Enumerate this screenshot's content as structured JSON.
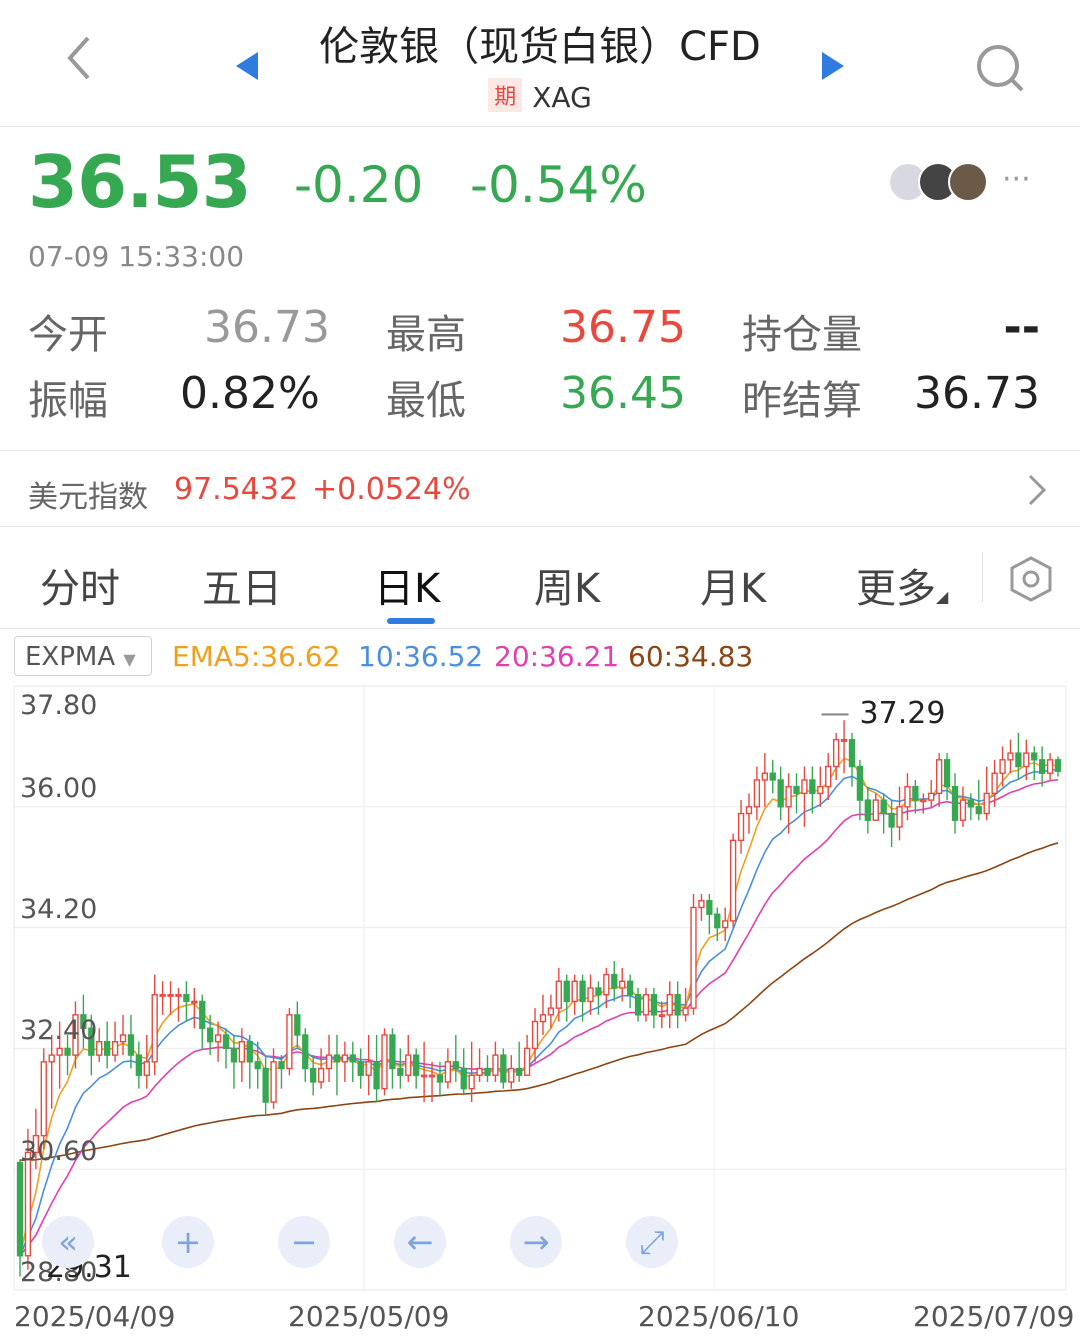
{
  "header": {
    "back_icon": "chevron-left-icon",
    "prev_icon": "triangle-left-icon",
    "next_icon": "triangle-right-icon",
    "search_icon": "search-icon",
    "title": "伦敦银（现货白银）CFD",
    "badge": "期",
    "symbol": "XAG"
  },
  "quote": {
    "price": "36.53",
    "change": "-0.20",
    "change_pct": "-0.54%",
    "timestamp": "07-09 15:33:00",
    "more_icon": "ellipsis-icon",
    "colors": {
      "down": "#36a852",
      "up": "#e8493f"
    }
  },
  "stats": [
    {
      "label": "今开",
      "value": "36.73",
      "color": "#999999"
    },
    {
      "label": "最高",
      "value": "36.75",
      "color": "#e8493f"
    },
    {
      "label": "持仓量",
      "value": "--",
      "color": "#222222"
    },
    {
      "label": "振幅",
      "value": "0.82%",
      "color": "#222222"
    },
    {
      "label": "最低",
      "value": "36.45",
      "color": "#36a852"
    },
    {
      "label": "昨结算",
      "value": "36.73",
      "color": "#222222"
    }
  ],
  "dollar_index": {
    "label": "美元指数",
    "value": "97.5432",
    "change": "+0.0524%",
    "arrow_icon": "chevron-right-icon"
  },
  "tabs": [
    {
      "label": "分时"
    },
    {
      "label": "五日"
    },
    {
      "label": "日K",
      "active": true
    },
    {
      "label": "周K"
    },
    {
      "label": "月K"
    },
    {
      "label": "更多"
    }
  ],
  "settings_icon": "hexagon-settings-icon",
  "indicator": {
    "selector": "EXPMA",
    "ema5": "EMA5:36.62",
    "ema10": "10:36.52",
    "ema20": "20:36.21",
    "ema60": "60:34.83",
    "colors": {
      "ema5": "#f0a020",
      "ema10": "#4a8fe0",
      "ema20": "#e040b0",
      "ema60": "#8b4513"
    }
  },
  "chart_data": {
    "type": "candlestick",
    "y_ticks": [
      "37.80",
      "36.00",
      "34.20",
      "32.40",
      "30.60",
      "28.80"
    ],
    "x_ticks": [
      "2025/04/09",
      "2025/05/09",
      "2025/06/10",
      "2025/07/09"
    ],
    "ylim": [
      28.8,
      37.8
    ],
    "max_label": "37.29",
    "min_label": "29.31",
    "candles": [
      [
        30.7,
        29.31,
        30.75,
        29.0
      ],
      [
        29.31,
        30.85,
        31.2,
        29.1
      ],
      [
        30.85,
        31.1,
        31.5,
        30.6
      ],
      [
        31.1,
        32.2,
        32.4,
        30.9
      ],
      [
        32.2,
        32.3,
        32.6,
        31.5
      ],
      [
        32.3,
        32.4,
        32.8,
        31.8
      ],
      [
        32.4,
        32.3,
        32.6,
        32.0
      ],
      [
        32.3,
        32.9,
        33.1,
        32.1
      ],
      [
        32.9,
        32.7,
        33.2,
        32.4
      ],
      [
        32.7,
        32.3,
        32.9,
        32.0
      ],
      [
        32.3,
        32.5,
        32.7,
        32.2
      ],
      [
        32.5,
        32.3,
        32.8,
        32.1
      ],
      [
        32.3,
        32.5,
        32.8,
        32.2
      ],
      [
        32.5,
        32.6,
        32.9,
        32.3
      ],
      [
        32.6,
        32.3,
        32.9,
        32.1
      ],
      [
        32.3,
        32.0,
        32.5,
        31.8
      ],
      [
        32.0,
        32.2,
        32.6,
        31.8
      ],
      [
        32.2,
        33.2,
        33.5,
        32.0
      ],
      [
        33.2,
        33.2,
        33.4,
        32.9
      ],
      [
        33.2,
        33.2,
        33.4,
        32.9
      ],
      [
        33.2,
        33.2,
        33.3,
        32.8
      ],
      [
        33.2,
        33.1,
        33.4,
        32.8
      ],
      [
        33.1,
        33.1,
        33.3,
        32.7
      ],
      [
        33.1,
        32.7,
        33.2,
        32.4
      ],
      [
        32.7,
        32.5,
        32.9,
        32.3
      ],
      [
        32.5,
        32.6,
        32.8,
        32.2
      ],
      [
        32.6,
        32.4,
        32.7,
        32.1
      ],
      [
        32.4,
        32.2,
        32.6,
        31.8
      ],
      [
        32.2,
        32.5,
        32.7,
        31.9
      ],
      [
        32.5,
        32.2,
        32.6,
        31.8
      ],
      [
        32.2,
        32.1,
        32.5,
        31.8
      ],
      [
        32.1,
        31.6,
        32.3,
        31.4
      ],
      [
        31.6,
        32.2,
        32.4,
        31.5
      ],
      [
        32.2,
        32.1,
        32.3,
        31.8
      ],
      [
        32.1,
        32.9,
        33.0,
        32.0
      ],
      [
        32.9,
        32.6,
        33.1,
        32.4
      ],
      [
        32.6,
        32.1,
        32.7,
        31.9
      ],
      [
        32.1,
        31.9,
        32.3,
        31.7
      ],
      [
        31.9,
        32.1,
        32.4,
        31.8
      ],
      [
        32.1,
        32.3,
        32.6,
        31.9
      ],
      [
        32.3,
        32.2,
        32.6,
        31.7
      ],
      [
        32.2,
        32.3,
        32.5,
        31.9
      ],
      [
        32.3,
        32.2,
        32.5,
        31.9
      ],
      [
        32.2,
        32.0,
        32.4,
        31.8
      ],
      [
        32.0,
        32.2,
        32.6,
        31.7
      ],
      [
        32.2,
        31.8,
        32.6,
        31.6
      ],
      [
        31.8,
        32.6,
        32.7,
        31.7
      ],
      [
        32.6,
        32.1,
        32.7,
        31.8
      ],
      [
        32.1,
        32.0,
        32.4,
        31.8
      ],
      [
        32.0,
        32.3,
        32.6,
        31.9
      ],
      [
        32.3,
        32.0,
        32.4,
        31.8
      ],
      [
        32.0,
        32.0,
        32.5,
        31.6
      ],
      [
        32.0,
        32.0,
        32.2,
        31.6
      ],
      [
        32.0,
        31.9,
        32.2,
        31.7
      ],
      [
        31.9,
        32.2,
        32.4,
        31.8
      ],
      [
        32.2,
        32.1,
        32.6,
        31.9
      ],
      [
        32.1,
        31.8,
        32.4,
        31.7
      ],
      [
        31.8,
        32.0,
        32.5,
        31.6
      ],
      [
        32.0,
        32.1,
        32.4,
        31.9
      ],
      [
        32.1,
        32.0,
        32.3,
        31.9
      ],
      [
        32.0,
        32.3,
        32.5,
        31.9
      ],
      [
        32.3,
        31.9,
        32.4,
        31.8
      ],
      [
        31.9,
        32.1,
        32.3,
        31.8
      ],
      [
        32.1,
        32.0,
        32.5,
        31.9
      ],
      [
        32.0,
        32.4,
        32.6,
        32.0
      ],
      [
        32.4,
        32.8,
        33.0,
        32.2
      ],
      [
        32.8,
        32.9,
        33.2,
        32.6
      ],
      [
        32.9,
        33.0,
        33.2,
        32.7
      ],
      [
        33.0,
        33.4,
        33.6,
        32.8
      ],
      [
        33.4,
        33.1,
        33.5,
        32.8
      ],
      [
        33.1,
        33.4,
        33.5,
        32.9
      ],
      [
        33.4,
        33.1,
        33.5,
        32.8
      ],
      [
        33.1,
        33.3,
        33.5,
        32.9
      ],
      [
        33.3,
        33.2,
        33.4,
        32.9
      ],
      [
        33.2,
        33.5,
        33.6,
        33.0
      ],
      [
        33.5,
        33.3,
        33.7,
        33.1
      ],
      [
        33.3,
        33.4,
        33.6,
        33.1
      ],
      [
        33.4,
        33.2,
        33.5,
        33.0
      ],
      [
        33.2,
        32.9,
        33.3,
        32.8
      ],
      [
        32.9,
        33.2,
        33.3,
        32.8
      ],
      [
        33.2,
        32.9,
        33.3,
        32.7
      ],
      [
        32.9,
        32.9,
        33.1,
        32.7
      ],
      [
        32.9,
        33.2,
        33.4,
        32.7
      ],
      [
        33.2,
        32.9,
        33.4,
        32.7
      ],
      [
        32.9,
        33.0,
        33.3,
        32.8
      ],
      [
        33.0,
        34.5,
        34.7,
        32.9
      ],
      [
        34.5,
        34.6,
        34.7,
        34.3
      ],
      [
        34.6,
        34.4,
        34.7,
        34.1
      ],
      [
        34.4,
        34.2,
        34.5,
        34.0
      ],
      [
        34.2,
        34.3,
        34.5,
        34.0
      ],
      [
        34.3,
        35.5,
        35.6,
        34.2
      ],
      [
        35.5,
        35.9,
        36.1,
        35.3
      ],
      [
        35.9,
        36.0,
        36.2,
        35.6
      ],
      [
        36.0,
        36.4,
        36.6,
        35.8
      ],
      [
        36.4,
        36.5,
        36.8,
        36.0
      ],
      [
        36.5,
        36.4,
        36.7,
        36.2
      ],
      [
        36.4,
        36.0,
        36.6,
        35.8
      ],
      [
        36.0,
        36.3,
        36.5,
        35.6
      ],
      [
        36.3,
        36.2,
        36.5,
        35.9
      ],
      [
        36.2,
        36.4,
        36.6,
        35.7
      ],
      [
        36.4,
        36.2,
        36.6,
        35.9
      ],
      [
        36.2,
        36.3,
        36.6,
        36.0
      ],
      [
        36.3,
        36.6,
        36.8,
        36.1
      ],
      [
        36.6,
        37.0,
        37.1,
        36.4
      ],
      [
        37.0,
        37.0,
        37.29,
        36.5
      ],
      [
        37.0,
        36.6,
        37.1,
        36.3
      ],
      [
        36.6,
        36.1,
        36.7,
        35.8
      ],
      [
        36.1,
        35.8,
        36.3,
        35.6
      ],
      [
        35.8,
        36.1,
        36.2,
        35.8
      ],
      [
        36.1,
        35.9,
        36.2,
        35.6
      ],
      [
        35.9,
        35.7,
        36.1,
        35.4
      ],
      [
        35.7,
        36.0,
        36.3,
        35.5
      ],
      [
        36.0,
        36.3,
        36.5,
        35.8
      ],
      [
        36.3,
        36.1,
        36.4,
        35.9
      ],
      [
        36.1,
        36.1,
        36.2,
        35.9
      ],
      [
        36.1,
        36.2,
        36.4,
        36.0
      ],
      [
        36.2,
        36.7,
        36.8,
        36.0
      ],
      [
        36.7,
        36.3,
        36.8,
        36.1
      ],
      [
        36.3,
        35.8,
        36.5,
        35.6
      ],
      [
        35.8,
        36.1,
        36.3,
        35.7
      ],
      [
        36.1,
        36.0,
        36.2,
        35.8
      ],
      [
        36.0,
        35.9,
        36.4,
        35.8
      ],
      [
        35.9,
        36.2,
        36.6,
        35.8
      ],
      [
        36.2,
        36.5,
        36.7,
        36.0
      ],
      [
        36.5,
        36.7,
        36.9,
        36.3
      ],
      [
        36.7,
        36.8,
        37.0,
        36.5
      ],
      [
        36.8,
        36.6,
        37.1,
        36.4
      ],
      [
        36.6,
        36.8,
        37.0,
        36.4
      ],
      [
        36.8,
        36.7,
        36.9,
        36.4
      ],
      [
        36.7,
        36.5,
        36.9,
        36.3
      ],
      [
        36.5,
        36.7,
        36.8,
        36.4
      ],
      [
        36.7,
        36.53,
        36.75,
        36.45
      ]
    ]
  },
  "chart_controls": [
    {
      "icon": "double-chevron-left-icon",
      "glyph": "«"
    },
    {
      "icon": "zoom-in-icon",
      "glyph": "+"
    },
    {
      "icon": "zoom-out-icon",
      "glyph": "−"
    },
    {
      "icon": "arrow-left-icon",
      "glyph": "←"
    },
    {
      "icon": "arrow-right-icon",
      "glyph": "→"
    },
    {
      "icon": "reset-icon",
      "glyph": "⤢"
    }
  ]
}
